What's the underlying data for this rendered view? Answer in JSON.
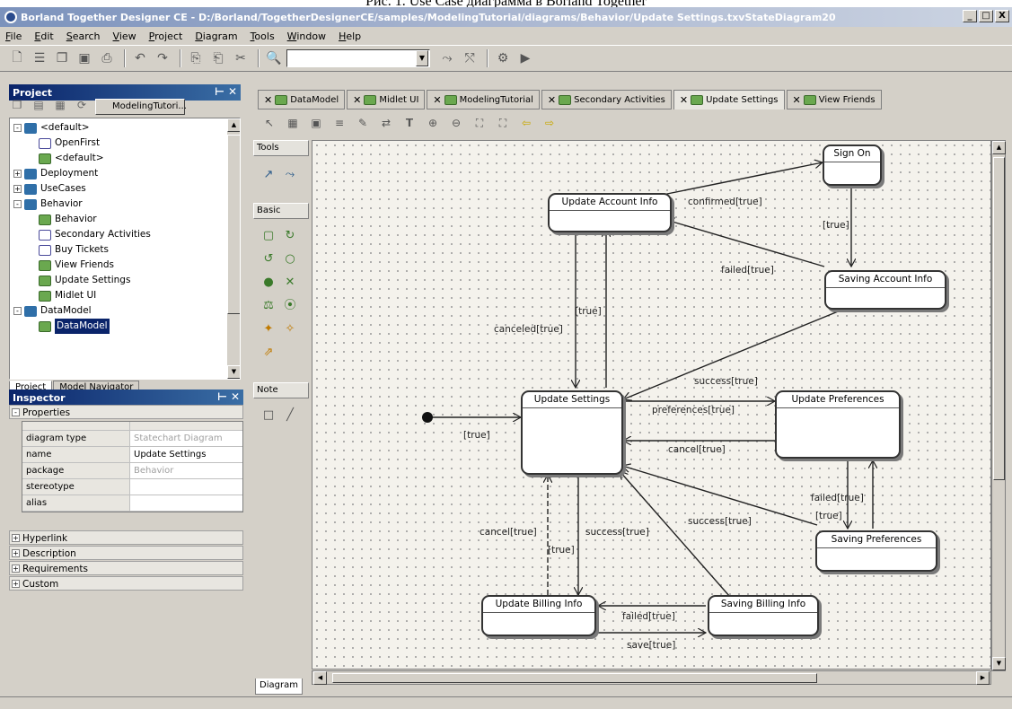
{
  "caption": "Рис. 1. Use Case диаграмма в Borland Together",
  "window": {
    "title": "Borland Together Designer CE - D:/Borland/TogetherDesignerCE/samples/ModelingTutorial/diagrams/Behavior/Update Settings.txvStateDiagram20",
    "minimize": "_",
    "maximize": "□",
    "close": "X"
  },
  "menu": [
    "File",
    "Edit",
    "Search",
    "View",
    "Project",
    "Diagram",
    "Tools",
    "Window",
    "Help"
  ],
  "project_panel": {
    "title": "Project",
    "combo_value": "ModelingTutori...",
    "tree": [
      {
        "label": "<default>",
        "level": 0,
        "type": "pkg",
        "exp": "-"
      },
      {
        "label": "OpenFirst",
        "level": 1,
        "type": "act"
      },
      {
        "label": "<default>",
        "level": 1,
        "type": "diag"
      },
      {
        "label": "Deployment",
        "level": 0,
        "type": "pkg",
        "exp": "+"
      },
      {
        "label": "UseCases",
        "level": 0,
        "type": "pkg",
        "exp": "+"
      },
      {
        "label": "Behavior",
        "level": 0,
        "type": "pkg",
        "exp": "-"
      },
      {
        "label": "Behavior",
        "level": 1,
        "type": "diag"
      },
      {
        "label": "Secondary Activities",
        "level": 1,
        "type": "act"
      },
      {
        "label": "Buy Tickets",
        "level": 1,
        "type": "act"
      },
      {
        "label": "View Friends",
        "level": 1,
        "type": "diag"
      },
      {
        "label": "Update Settings",
        "level": 1,
        "type": "diag"
      },
      {
        "label": "Midlet UI",
        "level": 1,
        "type": "diag"
      },
      {
        "label": "DataModel",
        "level": 0,
        "type": "pkg",
        "exp": "-"
      },
      {
        "label": "DataModel",
        "level": 1,
        "type": "diag",
        "selected": true
      }
    ],
    "tabs": [
      "Project",
      "Model Navigator"
    ]
  },
  "inspector": {
    "title": "Inspector",
    "properties_label": "Properties",
    "properties": [
      {
        "key": "diagram type",
        "value": "Statechart Diagram",
        "grey": true
      },
      {
        "key": "name",
        "value": "Update Settings",
        "grey": false
      },
      {
        "key": "package",
        "value": "Behavior",
        "grey": true
      },
      {
        "key": "stereotype",
        "value": "",
        "grey": false
      },
      {
        "key": "alias",
        "value": "",
        "grey": false
      }
    ],
    "sections": [
      "Hyperlink",
      "Description",
      "Requirements",
      "Custom"
    ]
  },
  "diagram_tabs": [
    {
      "label": "DataModel",
      "active": false
    },
    {
      "label": "Midlet UI",
      "active": false
    },
    {
      "label": "ModelingTutorial",
      "active": false
    },
    {
      "label": "Secondary Activities",
      "active": false
    },
    {
      "label": "Update Settings",
      "active": true
    },
    {
      "label": "View Friends",
      "active": false
    }
  ],
  "palette": {
    "tools": "Tools",
    "basic": "Basic",
    "note": "Note"
  },
  "states": {
    "sign_on": "Sign On",
    "update_account_info": "Update Account Info",
    "saving_account_info": "Saving Account Info",
    "update_settings": "Update Settings",
    "update_preferences": "Update Preferences",
    "saving_preferences": "Saving Preferences",
    "update_billing_info": "Update Billing Info",
    "saving_billing_info": "Saving Billing Info"
  },
  "transitions": {
    "confirmed": "confirmed[true]",
    "true_sign_saving": "[true]",
    "failed_account": "failed[true]",
    "canceled": "canceled[true]",
    "true_up": "[true]",
    "initial": "[true]",
    "success_account": "success[true]",
    "preferences": "preferences[true]",
    "cancel_prefs": "cancel[true]",
    "failed_prefs": "failed[true]",
    "true_prefs": "[true]",
    "success_prefs": "success[true]",
    "cancel_billing": "cancel[true]",
    "true_billing": "[true]",
    "success_billing": "success[true]",
    "failed_billing": "failed[true]",
    "save": "save[true]"
  },
  "bottom_tab": "Diagram"
}
